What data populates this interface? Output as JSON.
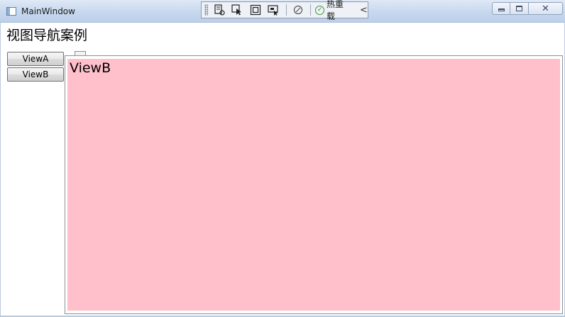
{
  "window": {
    "title": "MainWindow",
    "controls": [
      "minimize-icon",
      "maximize-icon",
      "close-icon"
    ]
  },
  "debug_toolbar": {
    "icons": [
      "select-visual-tree-icon",
      "select-element-icon",
      "display-layout-adorners-icon",
      "track-focus-icon",
      "binding-failures-icon"
    ],
    "hot_reload_label": "热重载",
    "collapse_glyph": "<"
  },
  "page": {
    "title": "视图导航案例"
  },
  "nav": {
    "buttons": [
      {
        "label": "ViewA"
      },
      {
        "label": "ViewB"
      }
    ]
  },
  "content": {
    "view_label": "ViewB",
    "background_color": "#ffc0cb"
  }
}
